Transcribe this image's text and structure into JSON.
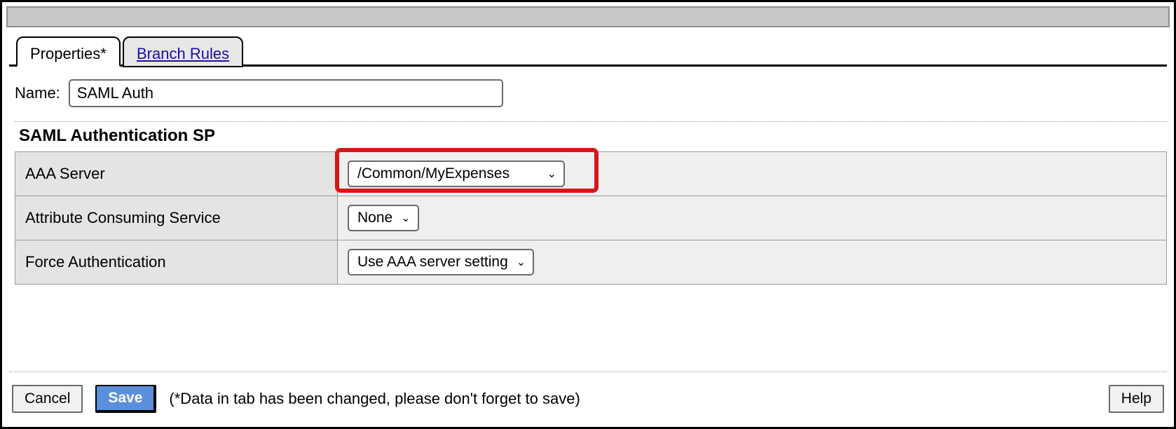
{
  "tabs": {
    "properties": "Properties*",
    "branch_rules": "Branch Rules"
  },
  "name_label": "Name:",
  "name_value": "SAML Auth",
  "section_title": "SAML Authentication SP",
  "rows": {
    "aaa_server": {
      "label": "AAA Server",
      "value": "/Common/MyExpenses"
    },
    "attr_consuming": {
      "label": "Attribute Consuming Service",
      "value": "None"
    },
    "force_auth": {
      "label": "Force Authentication",
      "value": "Use AAA server setting"
    }
  },
  "footer": {
    "cancel": "Cancel",
    "save": "Save",
    "note": "(*Data in tab has been changed, please don't forget to save)",
    "help": "Help"
  }
}
